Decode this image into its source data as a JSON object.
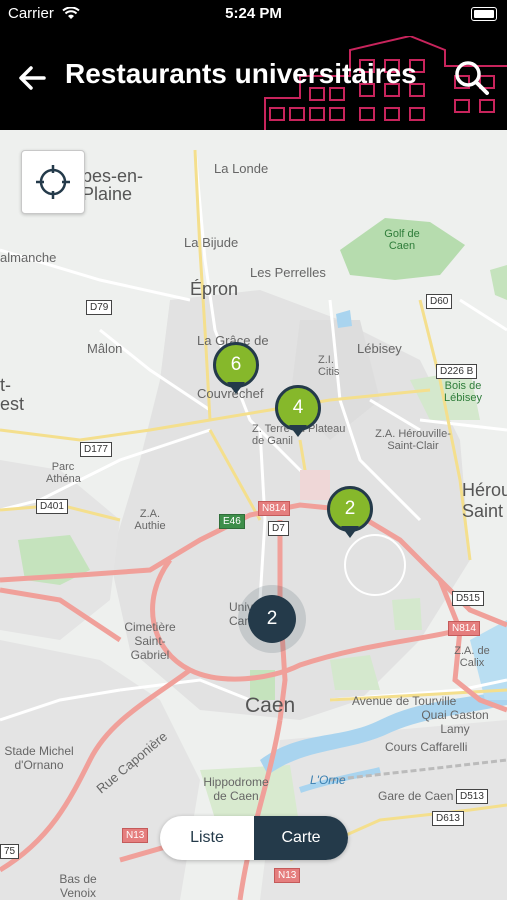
{
  "status_bar": {
    "carrier": "Carrier",
    "time": "5:24 PM"
  },
  "header": {
    "title": "Restaurants universitaires",
    "back_icon": "arrow-left-icon",
    "search_icon": "search-icon"
  },
  "map": {
    "place_labels": [
      {
        "id": "bes",
        "text": "bes-en-"
      },
      {
        "id": "plaine",
        "text": "Plaine"
      },
      {
        "id": "lalonde",
        "text": "La Londe"
      },
      {
        "id": "labijude",
        "text": "La Bijude"
      },
      {
        "id": "almanche",
        "text": "almanche"
      },
      {
        "id": "epron",
        "text": "Épron"
      },
      {
        "id": "perrelles",
        "text": "Les Perrelles"
      },
      {
        "id": "golf",
        "text": "Golf de Caen"
      },
      {
        "id": "malon",
        "text": "Mâlon"
      },
      {
        "id": "lagrace",
        "text": "La Grâce de"
      },
      {
        "id": "couvrechef",
        "text": "Couvrechef"
      },
      {
        "id": "lebisey",
        "text": "Lébisey"
      },
      {
        "id": "zicitis",
        "text": "Z.I. Citis"
      },
      {
        "id": "boisdelebisey",
        "text": "Bois de Lébisey"
      },
      {
        "id": "plateau",
        "text": "Z. Terre du Plateau de Ganil"
      },
      {
        "id": "herouville_za",
        "text": "Z.A. Hérouville-Saint-Clair"
      },
      {
        "id": "herouville",
        "text": "Hérou Saint"
      },
      {
        "id": "tst",
        "text": "t-"
      },
      {
        "id": "est",
        "text": "est"
      },
      {
        "id": "parcathena",
        "text": "Parc Athéna"
      },
      {
        "id": "zaauthie",
        "text": "Z.A. Authie"
      },
      {
        "id": "cimetiere",
        "text": "Cimetière Saint-Gabriel"
      },
      {
        "id": "univ",
        "text": "Univ Cam"
      },
      {
        "id": "zacalix",
        "text": "Z.A. de Calix"
      },
      {
        "id": "caen",
        "text": "Caen"
      },
      {
        "id": "tourville",
        "text": "Avenue de Tourville"
      },
      {
        "id": "quaigaston",
        "text": "Quai Gaston Lamy"
      },
      {
        "id": "caffarelli",
        "text": "Cours Caffarelli"
      },
      {
        "id": "stademichel",
        "text": "Stade Michel d'Ornano"
      },
      {
        "id": "ruecaponiere",
        "text": "Rue Caponière"
      },
      {
        "id": "hippodrome",
        "text": "Hippodrome de Caen"
      },
      {
        "id": "lorne",
        "text": "L'Orne"
      },
      {
        "id": "garedecaen",
        "text": "Gare de Caen"
      },
      {
        "id": "basdevenoix",
        "text": "Bas de Venoix"
      }
    ],
    "road_signs": [
      "D79",
      "D60",
      "D226 B",
      "D177",
      "D401",
      "E46",
      "N814",
      "D7",
      "D515",
      "N814",
      "D513",
      "D613",
      "N13",
      "N13",
      "75"
    ],
    "markers": [
      {
        "id": "m6",
        "count": "6"
      },
      {
        "id": "m4",
        "count": "4"
      },
      {
        "id": "m2",
        "count": "2"
      }
    ],
    "cluster": {
      "count": "2"
    },
    "locate_icon": "crosshair-icon"
  },
  "view_toggle": {
    "liste_label": "Liste",
    "carte_label": "Carte",
    "selected": "Carte"
  },
  "colors": {
    "accent": "#86b82b",
    "dark": "#243a4a",
    "header_bg": "#000000",
    "road": "#f0a09a"
  }
}
